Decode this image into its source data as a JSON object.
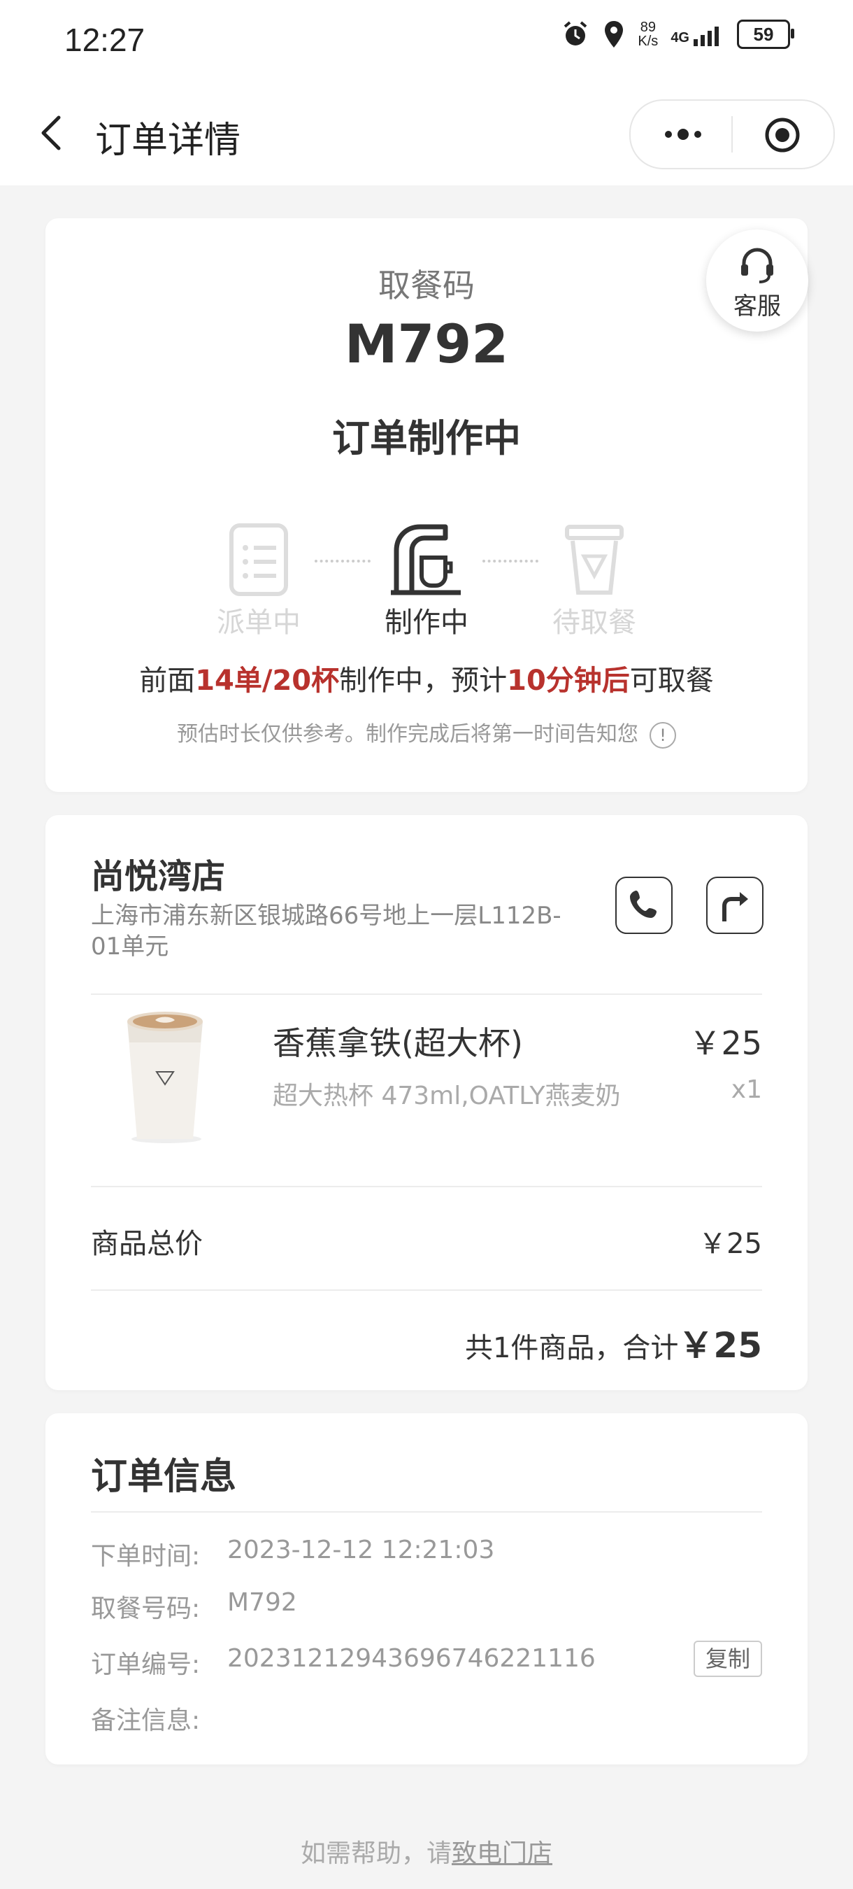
{
  "status_bar": {
    "time": "12:27",
    "net_speed_value": "89",
    "net_speed_unit": "K/s",
    "network": "4G",
    "battery": "59"
  },
  "nav": {
    "title": "订单详情"
  },
  "order_card": {
    "pickup_label": "取餐码",
    "pickup_code": "M792",
    "status": "订单制作中",
    "customer_service": "客服",
    "steps": [
      {
        "label": "派单中",
        "active": false
      },
      {
        "label": "制作中",
        "active": true
      },
      {
        "label": "待取餐",
        "active": false
      }
    ],
    "queue_prefix": "前面",
    "queue_count": "14单/20杯",
    "queue_mid": "制作中，预计",
    "queue_time": "10分钟后",
    "queue_suffix": "可取餐",
    "note": "预估时长仅供参考。制作完成后将第一时间告知您",
    "accent_color": "#b8322d"
  },
  "store_card": {
    "store_name": "尚悦湾店",
    "address": "上海市浦东新区银城路66号地上一层L112B-01单元",
    "product": {
      "name": "香蕉拿铁(超大杯)",
      "spec": "超大热杯 473ml,OATLY燕麦奶",
      "price": "￥25",
      "qty": "x1"
    },
    "subtotal_label": "商品总价",
    "subtotal_value": "￥25",
    "total_prefix": "共1件商品，合计",
    "total_value": "￥25"
  },
  "info_card": {
    "title": "订单信息",
    "rows": [
      {
        "label": "下单时间:",
        "value": "2023-12-12 12:21:03"
      },
      {
        "label": "取餐号码:",
        "value": "M792"
      },
      {
        "label": "订单编号:",
        "value": "20231212943696746221116"
      },
      {
        "label": "备注信息:",
        "value": ""
      }
    ],
    "copy_label": "复制"
  },
  "footer": {
    "prefix": "如需帮助，请",
    "link": "致电门店"
  }
}
